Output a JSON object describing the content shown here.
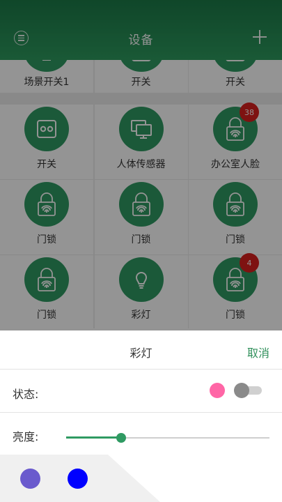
{
  "header": {
    "title": "设备"
  },
  "tiles": [
    {
      "label": "场景开关1",
      "icon": "scene-screen-icon",
      "badge": ""
    },
    {
      "label": "开关",
      "icon": "switch-icon",
      "badge": ""
    },
    {
      "label": "开关",
      "icon": "switch-icon",
      "badge": ""
    },
    {
      "label": "开关",
      "icon": "switch-icon",
      "badge": ""
    },
    {
      "label": "人体传感器",
      "icon": "motion-sensor-icon",
      "badge": ""
    },
    {
      "label": "办公室人脸",
      "icon": "fingerprint-lock-icon",
      "badge": "38"
    },
    {
      "label": "门锁",
      "icon": "fingerprint-lock-icon",
      "badge": ""
    },
    {
      "label": "门锁",
      "icon": "fingerprint-lock-icon",
      "badge": ""
    },
    {
      "label": "门锁",
      "icon": "fingerprint-lock-icon",
      "badge": ""
    },
    {
      "label": "门锁",
      "icon": "fingerprint-lock-icon",
      "badge": ""
    },
    {
      "label": "彩灯",
      "icon": "bulb-icon",
      "badge": ""
    },
    {
      "label": "门锁",
      "icon": "fingerprint-lock-icon",
      "badge": "4"
    }
  ],
  "sheet": {
    "title": "彩灯",
    "cancel_label": "取消",
    "state_label": "状态:",
    "state_color": "#ff66a6",
    "toggle_on": false,
    "brightness_label": "亮度:",
    "brightness_fraction": 0.27,
    "swatches": [
      "#6a5acd",
      "#0000ff"
    ]
  },
  "colors": {
    "accent": "#2f9a62",
    "header": "#1c7a48",
    "badge": "#d9201e"
  }
}
